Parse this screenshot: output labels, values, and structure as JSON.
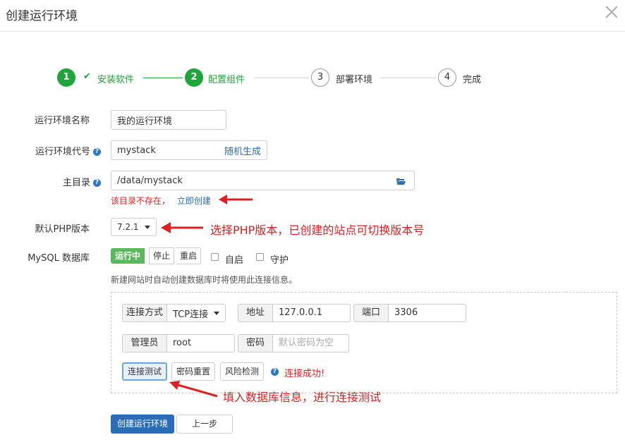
{
  "dialog": {
    "title": "创建运行环境"
  },
  "steps": [
    {
      "num": "1",
      "label": "安装软件",
      "state": "done"
    },
    {
      "num": "2",
      "label": "配置组件",
      "state": "active"
    },
    {
      "num": "3",
      "label": "部署环境",
      "state": "todo"
    },
    {
      "num": "4",
      "label": "完成",
      "state": "todo"
    }
  ],
  "form": {
    "env_name": {
      "label": "运行环境名称",
      "value": "我的运行环境"
    },
    "env_code": {
      "label": "运行环境代号",
      "value": "mystack",
      "action": "随机生成"
    },
    "root_dir": {
      "label": "主目录",
      "value": "/data/mystack",
      "error": "该目录不存在，",
      "create_link": "立即创建"
    },
    "php_version": {
      "label": "默认PHP版本",
      "value": "7.2.1"
    },
    "mysql": {
      "label": "MySQL 数据库",
      "status": "运行中",
      "stop": "停止",
      "restart": "重启",
      "autostart": "自启",
      "guard": "守护",
      "note": "新建网站时自动创建数据库时将使用此连接信息。"
    }
  },
  "db_panel": {
    "conn_method_label": "连接方式",
    "conn_method_value": "TCP连接",
    "addr_label": "地址",
    "addr_value": "127.0.0.1",
    "port_label": "端口",
    "port_value": "3306",
    "admin_label": "管理员",
    "admin_value": "root",
    "pwd_label": "密码",
    "pwd_placeholder": "默认密码为空",
    "test_btn": "连接测试",
    "reset_btn": "密码重置",
    "risk_btn": "风险检测",
    "success": "连接成功!"
  },
  "annotations": {
    "php": "选择PHP版本，已创建的站点可切换版本号",
    "db": "填入数据库信息，进行连接测试"
  },
  "footer": {
    "create": "创建运行环境",
    "prev": "上一步"
  },
  "colors": {
    "green": "#20a53a",
    "blue": "#2a6cb8",
    "red": "#e02020"
  }
}
